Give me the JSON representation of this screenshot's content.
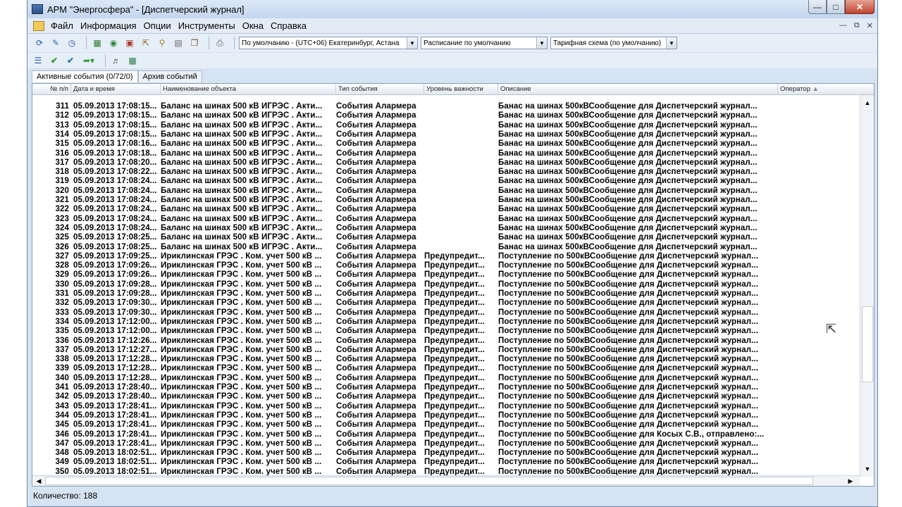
{
  "window": {
    "title": "АРМ \"Энергосфера\" - [Диспетчерский журнал]"
  },
  "menu": [
    "Файл",
    "Информация",
    "Опции",
    "Инструменты",
    "Окна",
    "Справка"
  ],
  "toolbar": {
    "timezone": "По умолчанию - (UTC+06) Екатеринбург, Астана",
    "schedule": "Расписание по умолчанию",
    "tariff": "Тарифная схема (по умолчанию)"
  },
  "tabs": [
    "Активные события (0/72/0)",
    "Архив событий"
  ],
  "columns": [
    "№ п/п",
    "Дата и время",
    "Наименование объекта",
    "Тип события",
    "Уровень важности",
    "Описание",
    "Оператор"
  ],
  "rows": [
    [
      "311",
      "05.09.2013 17:08:15...",
      "Баланс на шинах 500 кВ ИГРЭС . Акти...",
      "События Алармера",
      "",
      "Банас на шинах 500кВСообщение для Диспетчерский журнал..."
    ],
    [
      "312",
      "05.09.2013 17:08:15...",
      "Баланс на шинах 500 кВ ИГРЭС . Акти...",
      "События Алармера",
      "",
      "Банас на шинах 500кВСообщение для Диспетчерский журнал..."
    ],
    [
      "313",
      "05.09.2013 17:08:15...",
      "Баланс на шинах 500 кВ ИГРЭС . Акти...",
      "События Алармера",
      "",
      "Банас на шинах 500кВСообщение для Диспетчерский журнал..."
    ],
    [
      "314",
      "05.09.2013 17:08:15...",
      "Баланс на шинах 500 кВ ИГРЭС . Акти...",
      "События Алармера",
      "",
      "Банас на шинах 500кВСообщение для Диспетчерский журнал..."
    ],
    [
      "315",
      "05.09.2013 17:08:16...",
      "Баланс на шинах 500 кВ ИГРЭС . Акти...",
      "События Алармера",
      "",
      "Банас на шинах 500кВСообщение для Диспетчерский журнал..."
    ],
    [
      "316",
      "05.09.2013 17:08:18...",
      "Баланс на шинах 500 кВ ИГРЭС . Акти...",
      "События Алармера",
      "",
      "Банас на шинах 500кВСообщение для Диспетчерский журнал..."
    ],
    [
      "317",
      "05.09.2013 17:08:20...",
      "Баланс на шинах 500 кВ ИГРЭС . Акти...",
      "События Алармера",
      "",
      "Банас на шинах 500кВСообщение для Диспетчерский журнал..."
    ],
    [
      "318",
      "05.09.2013 17:08:22...",
      "Баланс на шинах 500 кВ ИГРЭС . Акти...",
      "События Алармера",
      "",
      "Банас на шинах 500кВСообщение для Диспетчерский журнал..."
    ],
    [
      "319",
      "05.09.2013 17:08:24...",
      "Баланс на шинах 500 кВ ИГРЭС . Акти...",
      "События Алармера",
      "",
      "Банас на шинах 500кВСообщение для Диспетчерский журнал..."
    ],
    [
      "320",
      "05.09.2013 17:08:24...",
      "Баланс на шинах 500 кВ ИГРЭС . Акти...",
      "События Алармера",
      "",
      "Банас на шинах 500кВСообщение для Диспетчерский журнал..."
    ],
    [
      "321",
      "05.09.2013 17:08:24...",
      "Баланс на шинах 500 кВ ИГРЭС . Акти...",
      "События Алармера",
      "",
      "Банас на шинах 500кВСообщение для Диспетчерский журнал..."
    ],
    [
      "322",
      "05.09.2013 17:08:24...",
      "Баланс на шинах 500 кВ ИГРЭС . Акти...",
      "События Алармера",
      "",
      "Банас на шинах 500кВСообщение для Диспетчерский журнал..."
    ],
    [
      "323",
      "05.09.2013 17:08:24...",
      "Баланс на шинах 500 кВ ИГРЭС . Акти...",
      "События Алармера",
      "",
      "Банас на шинах 500кВСообщение для Диспетчерский журнал..."
    ],
    [
      "324",
      "05.09.2013 17:08:24...",
      "Баланс на шинах 500 кВ ИГРЭС . Акти...",
      "События Алармера",
      "",
      "Банас на шинах 500кВСообщение для Диспетчерский журнал..."
    ],
    [
      "325",
      "05.09.2013 17:08:25...",
      "Баланс на шинах 500 кВ ИГРЭС . Акти...",
      "События Алармера",
      "",
      "Банас на шинах 500кВСообщение для Диспетчерский журнал..."
    ],
    [
      "326",
      "05.09.2013 17:08:25...",
      "Баланс на шинах 500 кВ ИГРЭС . Акти...",
      "События Алармера",
      "",
      "Банас на шинах 500кВСообщение для Диспетчерский журнал..."
    ],
    [
      "327",
      "05.09.2013 17:09:25...",
      "Ириклинская ГРЭС . Ком. учет 500 кВ ...",
      "События Алармера",
      "Предупредит...",
      "Поступление по 500кВСообщение для Диспетчерский журнал..."
    ],
    [
      "328",
      "05.09.2013 17:09:26...",
      "Ириклинская ГРЭС . Ком. учет 500 кВ ...",
      "События Алармера",
      "Предупредит...",
      "Поступление по 500кВСообщение для Диспетчерский журнал..."
    ],
    [
      "329",
      "05.09.2013 17:09:26...",
      "Ириклинская ГРЭС . Ком. учет 500 кВ ...",
      "События Алармера",
      "Предупредит...",
      "Поступление по 500кВСообщение для Диспетчерский журнал..."
    ],
    [
      "330",
      "05.09.2013 17:09:28...",
      "Ириклинская ГРЭС . Ком. учет 500 кВ ...",
      "События Алармера",
      "Предупредит...",
      "Поступление по 500кВСообщение для Диспетчерский журнал..."
    ],
    [
      "331",
      "05.09.2013 17:09:28...",
      "Ириклинская ГРЭС . Ком. учет 500 кВ ...",
      "События Алармера",
      "Предупредит...",
      "Поступление по 500кВСообщение для Диспетчерский журнал..."
    ],
    [
      "332",
      "05.09.2013 17:09:30...",
      "Ириклинская ГРЭС . Ком. учет 500 кВ ...",
      "События Алармера",
      "Предупредит...",
      "Поступление по 500кВСообщение для Диспетчерский журнал..."
    ],
    [
      "333",
      "05.09.2013 17:09:30...",
      "Ириклинская ГРЭС . Ком. учет 500 кВ ...",
      "События Алармера",
      "Предупредит...",
      "Поступление по 500кВСообщение для Диспетчерский журнал..."
    ],
    [
      "334",
      "05.09.2013 17:12:00...",
      "Ириклинская ГРЭС . Ком. учет 500 кВ ...",
      "События Алармера",
      "Предупредит...",
      "Поступление по 500кВСообщение для Диспетчерский журнал..."
    ],
    [
      "335",
      "05.09.2013 17:12:00...",
      "Ириклинская ГРЭС . Ком. учет 500 кВ ...",
      "События Алармера",
      "Предупредит...",
      "Поступление по 500кВСообщение для Диспетчерский журнал..."
    ],
    [
      "336",
      "05.09.2013 17:12:26...",
      "Ириклинская ГРЭС . Ком. учет 500 кВ ...",
      "События Алармера",
      "Предупредит...",
      "Поступление по 500кВСообщение для Диспетчерский журнал..."
    ],
    [
      "337",
      "05.09.2013 17:12:27...",
      "Ириклинская ГРЭС . Ком. учет 500 кВ ...",
      "События Алармера",
      "Предупредит...",
      "Поступление по 500кВСообщение для Диспетчерский журнал..."
    ],
    [
      "338",
      "05.09.2013 17:12:28...",
      "Ириклинская ГРЭС . Ком. учет 500 кВ ...",
      "События Алармера",
      "Предупредит...",
      "Поступление по 500кВСообщение для Диспетчерский журнал..."
    ],
    [
      "339",
      "05.09.2013 17:12:28...",
      "Ириклинская ГРЭС . Ком. учет 500 кВ ...",
      "События Алармера",
      "Предупредит...",
      "Поступление по 500кВСообщение для Диспетчерский журнал..."
    ],
    [
      "340",
      "05.09.2013 17:12:28...",
      "Ириклинская ГРЭС . Ком. учет 500 кВ ...",
      "События Алармера",
      "Предупредит...",
      "Поступление по 500кВСообщение для Диспетчерский журнал..."
    ],
    [
      "341",
      "05.09.2013 17:28:40...",
      "Ириклинская ГРЭС . Ком. учет 500 кВ ...",
      "События Алармера",
      "Предупредит...",
      "Поступление по 500кВСообщение для Диспетчерский журнал..."
    ],
    [
      "342",
      "05.09.2013 17:28:40...",
      "Ириклинская ГРЭС . Ком. учет 500 кВ ...",
      "События Алармера",
      "Предупредит...",
      "Поступление по 500кВСообщение для Диспетчерский журнал..."
    ],
    [
      "343",
      "05.09.2013 17:28:41...",
      "Ириклинская ГРЭС . Ком. учет 500 кВ ...",
      "События Алармера",
      "Предупредит...",
      "Поступление по 500кВСообщение для Диспетчерский журнал..."
    ],
    [
      "344",
      "05.09.2013 17:28:41...",
      "Ириклинская ГРЭС . Ком. учет 500 кВ ...",
      "События Алармера",
      "Предупредит...",
      "Поступление по 500кВСообщение для Диспетчерский журнал..."
    ],
    [
      "345",
      "05.09.2013 17:28:41...",
      "Ириклинская ГРЭС . Ком. учет 500 кВ ...",
      "События Алармера",
      "Предупредит...",
      "Поступление по 500кВСообщение для Диспетчерский журнал..."
    ],
    [
      "346",
      "05.09.2013 17:28:41...",
      "Ириклинская ГРЭС . Ком. учет 500 кВ ...",
      "События Алармера",
      "Предупредит...",
      "Поступление по 500кВСообщение для Косых С.В., отправлено:..."
    ],
    [
      "347",
      "05.09.2013 17:28:41...",
      "Ириклинская ГРЭС . Ком. учет 500 кВ ...",
      "События Алармера",
      "Предупредит...",
      "Поступление по 500кВСообщение для Диспетчерский журнал..."
    ],
    [
      "348",
      "05.09.2013 18:02:51...",
      "Ириклинская ГРЭС . Ком. учет 500 кВ ...",
      "События Алармера",
      "Предупредит...",
      "Поступление по 500кВСообщение для Диспетчерский журнал..."
    ],
    [
      "349",
      "05.09.2013 18:02:51...",
      "Ириклинская ГРЭС . Ком. учет 500 кВ ...",
      "События Алармера",
      "Предупредит...",
      "Поступление по 500кВСообщение для Диспетчерский журнал..."
    ],
    [
      "350",
      "05.09.2013 18:02:51...",
      "Ириклинская ГРЭС . Ком. учет 500 кВ ...",
      "События Алармера",
      "Предупредит...",
      "Поступление по 500кВСообщение для Диспетчерский журнал..."
    ]
  ],
  "status": "Количество: 188",
  "icons": [
    "refresh-icon",
    "edit-icon",
    "alarm-clock-icon",
    "chart-icon",
    "globe-icon",
    "table-icon",
    "export-icon",
    "search-icon",
    "print-preview-icon",
    "copy-icon",
    "print-icon",
    "list-icon",
    "check-icon",
    "check-all-icon",
    "forward-icon",
    "sound-icon",
    "calc-icon"
  ]
}
